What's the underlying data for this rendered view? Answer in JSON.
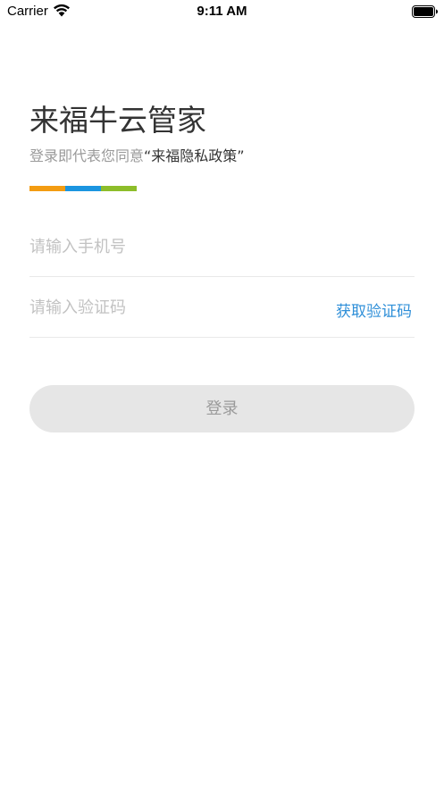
{
  "status_bar": {
    "carrier": "Carrier",
    "time": "9:11 AM"
  },
  "header": {
    "title": "来福牛云管家",
    "agreement_prefix": "登录即代表您同意",
    "policy_link": "“来福隐私政策”",
    "accent_colors": [
      "#f39c12",
      "#1b95e0",
      "#8dbd2a"
    ]
  },
  "form": {
    "phone_placeholder": "请输入手机号",
    "phone_value": "",
    "code_placeholder": "请输入验证码",
    "code_value": "",
    "get_code_label": "获取验证码",
    "login_label": "登录"
  },
  "colors": {
    "link": "#2f8fd8",
    "button_disabled_bg": "#e6e6e6",
    "button_disabled_text": "#9a9a9a"
  }
}
